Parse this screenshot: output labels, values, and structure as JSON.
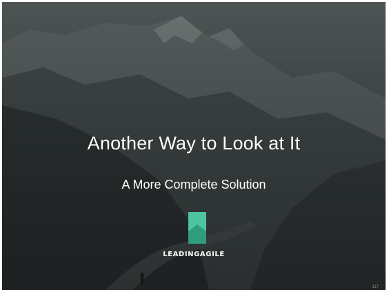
{
  "slide": {
    "title": "Another Way to Look at It",
    "subtitle": "A More Complete Solution",
    "logo_text": "LEADINGAGILE",
    "page_number": "117"
  },
  "colors": {
    "logo_light": "#4cc5a0",
    "logo_dark": "#2f9c7d",
    "text": "#ffffff"
  }
}
